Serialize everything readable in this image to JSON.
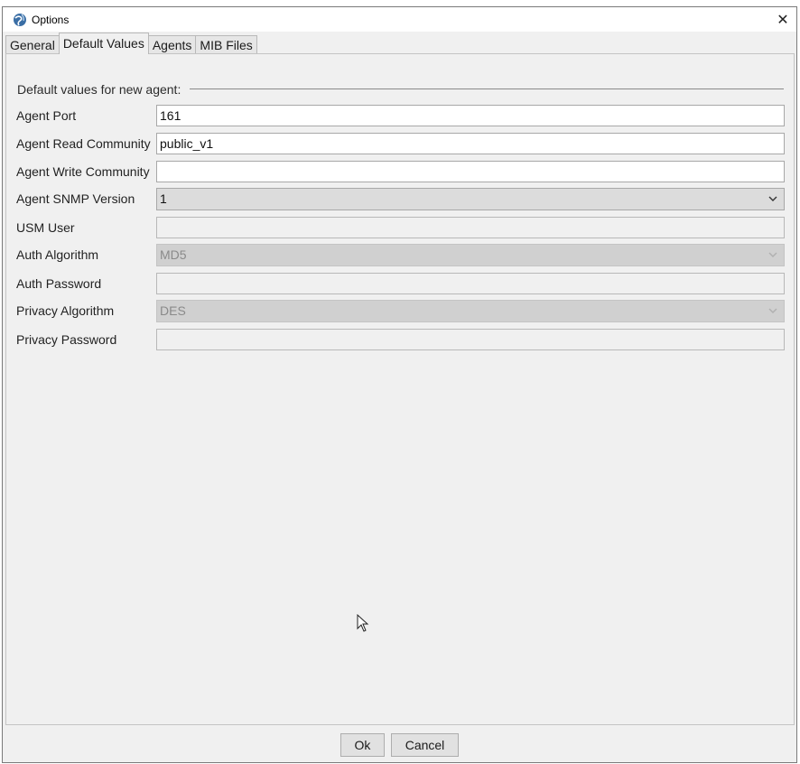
{
  "window": {
    "title": "Options",
    "close_glyph": "✕"
  },
  "tabs": [
    {
      "label": "General",
      "active": false
    },
    {
      "label": "Default Values",
      "active": true
    },
    {
      "label": "Agents",
      "active": false
    },
    {
      "label": "MIB Files",
      "active": false
    }
  ],
  "group": {
    "title": "Default values for new agent:"
  },
  "fields": {
    "agent_port": {
      "label": "Agent Port",
      "value": "161"
    },
    "read_community": {
      "label": "Agent Read Community",
      "value": "public_v1"
    },
    "write_community": {
      "label": "Agent Write Community",
      "value": ""
    },
    "snmp_version": {
      "label": "Agent SNMP Version",
      "value": "1"
    },
    "usm_user": {
      "label": "USM User",
      "value": ""
    },
    "auth_algorithm": {
      "label": "Auth Algorithm",
      "value": "MD5"
    },
    "auth_password": {
      "label": "Auth Password",
      "value": ""
    },
    "privacy_algorithm": {
      "label": "Privacy Algorithm",
      "value": "DES"
    },
    "privacy_password": {
      "label": "Privacy Password",
      "value": ""
    }
  },
  "buttons": {
    "ok_label": "Ok",
    "cancel_label": "Cancel"
  },
  "icons": {
    "app": "globe-icon",
    "close": "close-icon",
    "dropdown": "chevron-down-icon",
    "cursor": "mouse-pointer-icon"
  },
  "colors": {
    "window_bg": "#f0f0f0",
    "field_bg": "#ffffff",
    "combo_bg": "#dcdcdc",
    "disabled_combo_bg": "#d0d0d0"
  }
}
